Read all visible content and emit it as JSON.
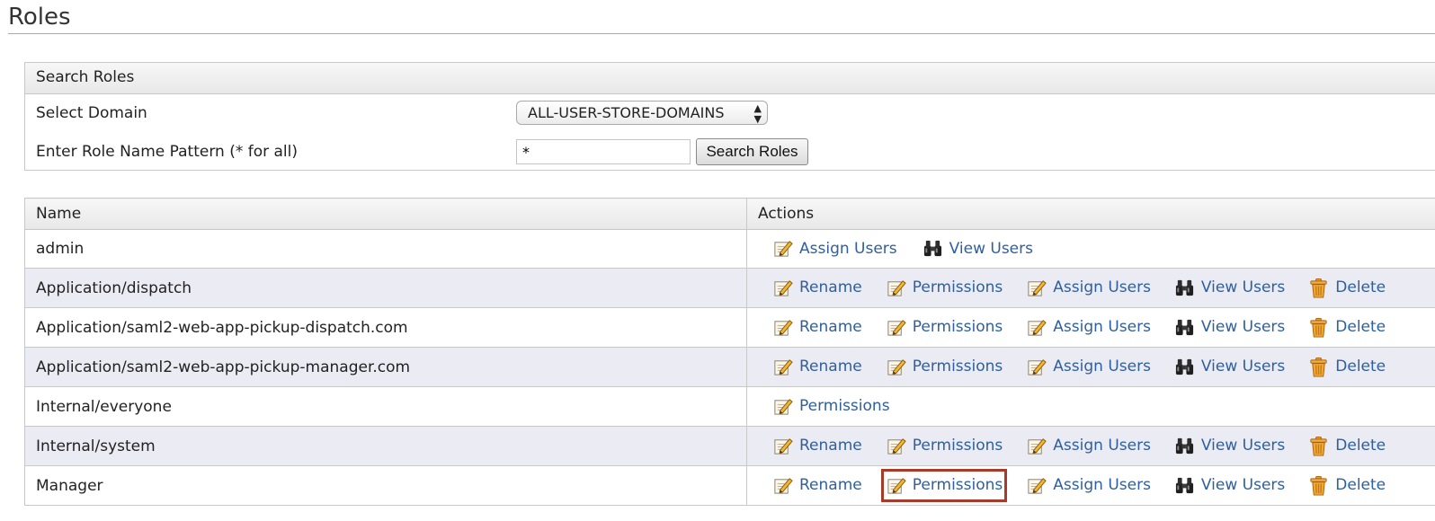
{
  "page": {
    "title": "Roles"
  },
  "search": {
    "header": "Search Roles",
    "domain_label": "Select Domain",
    "domain_value": "ALL-USER-STORE-DOMAINS",
    "pattern_label": "Enter Role Name Pattern (* for all)",
    "pattern_value": "*",
    "button_label": "Search Roles"
  },
  "table": {
    "headers": {
      "name": "Name",
      "actions": "Actions"
    },
    "action_labels": {
      "rename": "Rename",
      "permissions": "Permissions",
      "assign_users": "Assign Users",
      "view_users": "View Users",
      "delete": "Delete"
    },
    "icons": {
      "rename": "edit-pencil-icon",
      "permissions": "edit-pencil-icon",
      "assign_users": "edit-pencil-icon",
      "view_users": "binoculars-icon",
      "delete": "trash-can-icon"
    },
    "rows": [
      {
        "name": "admin",
        "actions": [
          "assign_users",
          "view_users"
        ]
      },
      {
        "name": "Application/dispatch",
        "actions": [
          "rename",
          "permissions",
          "assign_users",
          "view_users",
          "delete"
        ]
      },
      {
        "name": "Application/saml2-web-app-pickup-dispatch.com",
        "actions": [
          "rename",
          "permissions",
          "assign_users",
          "view_users",
          "delete"
        ]
      },
      {
        "name": "Application/saml2-web-app-pickup-manager.com",
        "actions": [
          "rename",
          "permissions",
          "assign_users",
          "view_users",
          "delete"
        ]
      },
      {
        "name": "Internal/everyone",
        "actions": [
          "permissions"
        ]
      },
      {
        "name": "Internal/system",
        "actions": [
          "rename",
          "permissions",
          "assign_users",
          "view_users",
          "delete"
        ]
      },
      {
        "name": "Manager",
        "actions": [
          "rename",
          "permissions",
          "assign_users",
          "view_users",
          "delete"
        ],
        "highlighted_action": "permissions"
      }
    ]
  },
  "colors": {
    "link": "#2f5f9e",
    "highlight": "#a93a2a",
    "alt_row": "#ebebf3"
  }
}
